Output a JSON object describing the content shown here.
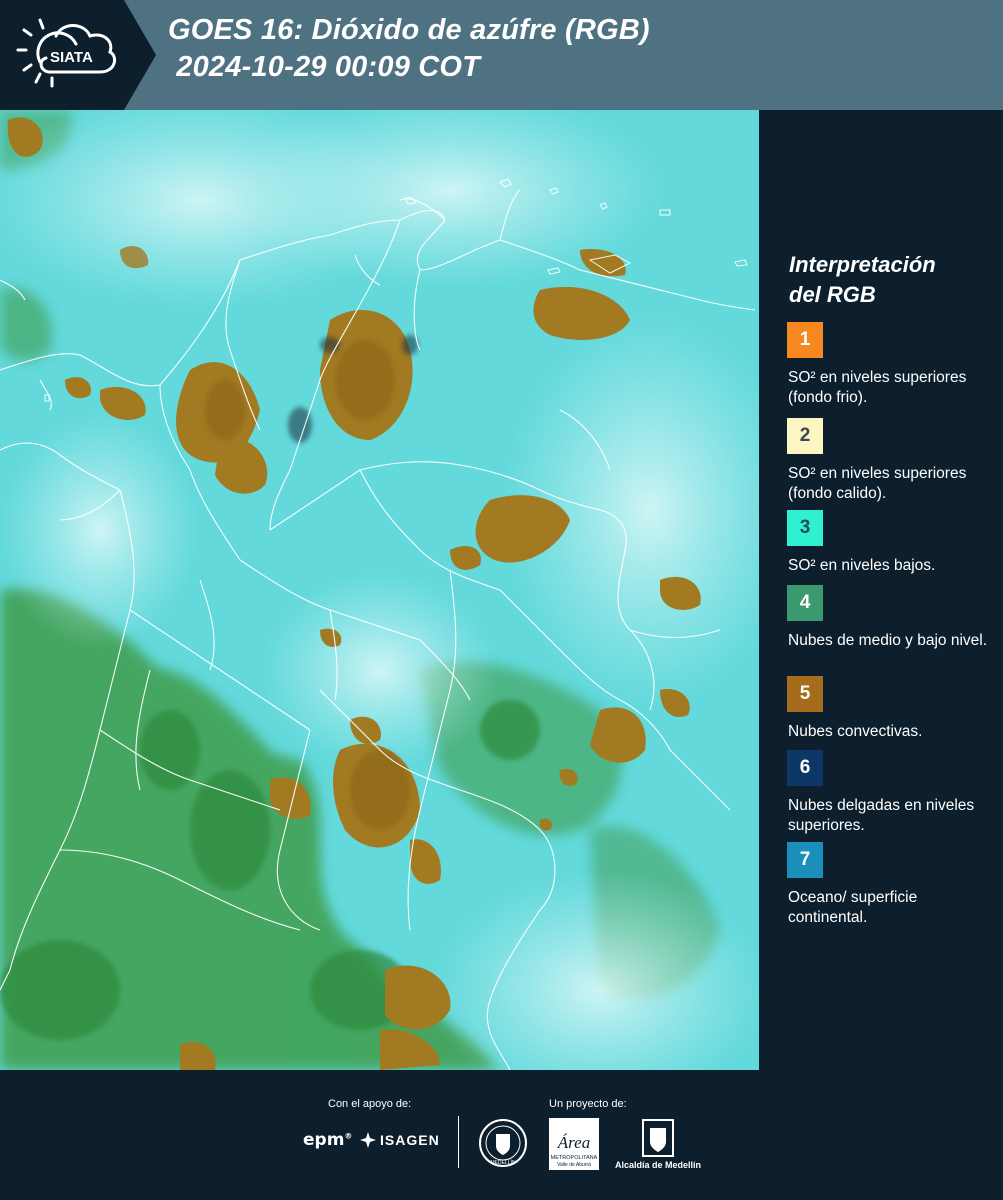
{
  "header": {
    "logo_text": "SIATA",
    "title_line1": "GOES 16: Dióxido de azúfre (RGB)",
    "title_line2": " 2024-10-29 00:09 COT"
  },
  "legend": {
    "title_line1": "Interpretación",
    "title_line2": "del RGB",
    "items": [
      {
        "number": "1",
        "label": "SO² en niveles superiores (fondo frio).",
        "color": "#f7871f",
        "text_color": "#ffffff"
      },
      {
        "number": "2",
        "label": "SO² en niveles superiores (fondo calido).",
        "color": "#fdf6c2",
        "text_color": "#3a4a55"
      },
      {
        "number": "3",
        "label": "SO² en niveles bajos.",
        "color": "#2ff0d0",
        "text_color": "#1e4d55"
      },
      {
        "number": "4",
        "label": "Nubes de medio y bajo nivel.",
        "color": "#3b9a6d",
        "text_color": "#ffffff"
      },
      {
        "number": "5",
        "label": "Nubes convectivas.",
        "color": "#a56c1c",
        "text_color": "#ffffff"
      },
      {
        "number": "6",
        "label": "Nubes delgadas en niveles superiores.",
        "color": "#0c3767",
        "text_color": "#ffffff"
      },
      {
        "number": "7",
        "label": "Oceano/ superficie continental.",
        "color": "#1a8fb9",
        "text_color": "#ffffff"
      }
    ]
  },
  "footer": {
    "support_label": "Con el apoyo de:",
    "project_label": "Un proyecto de:",
    "epm_logo": "epm",
    "isagen_logo": "ISAGEN",
    "amva_logo": "Área",
    "amva_sub1": "METROPOLITANA",
    "amva_sub2": "Valle de Aburrá",
    "seal_text": "MEDELLÍN",
    "alcaldia_logo": "Alcaldía de Medellín"
  },
  "colors": {
    "header_bg": "#4f7282",
    "panel_bg": "#0d1f2d",
    "cloud_brown": "#a0791f",
    "land_green": "#3e9a48",
    "sky_cyan": "#5fd8da",
    "borders": "#ffffff"
  }
}
